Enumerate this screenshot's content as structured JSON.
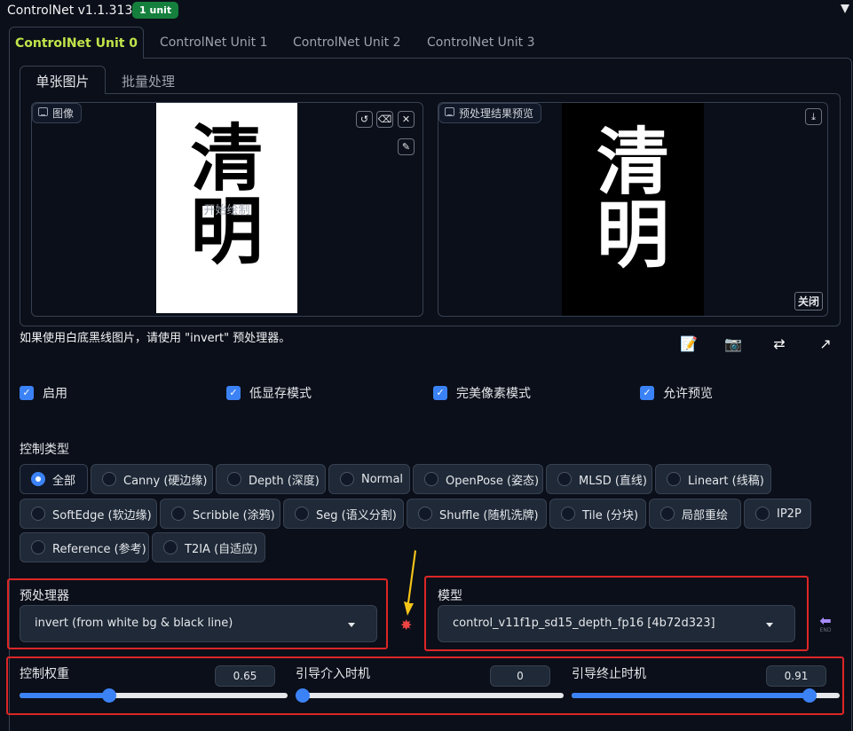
{
  "app": {
    "title": "ControlNet v1.1.313",
    "badge": "1 unit"
  },
  "unit_tabs": [
    "ControlNet Unit 0",
    "ControlNet Unit 1",
    "ControlNet Unit 2",
    "ControlNet Unit 3"
  ],
  "sub_tabs": [
    "单张图片",
    "批量处理"
  ],
  "image_panel": {
    "label": "图像",
    "overlay_text": "开始绘制",
    "calligraphy": "清明"
  },
  "preview_panel": {
    "label": "预处理结果预览",
    "close_label": "关闭",
    "calligraphy": "清明"
  },
  "note": "如果使用白底黑线图片，请使用 \"invert\" 预处理器。",
  "checkboxes": [
    {
      "label": "启用",
      "checked": true
    },
    {
      "label": "低显存模式",
      "checked": true
    },
    {
      "label": "完美像素模式",
      "checked": true
    },
    {
      "label": "允许预览",
      "checked": true
    }
  ],
  "control_type": {
    "label": "控制类型",
    "options": [
      "全部",
      "Canny (硬边缘)",
      "Depth (深度)",
      "Normal",
      "OpenPose (姿态)",
      "MLSD (直线)",
      "Lineart (线稿)",
      "SoftEdge (软边缘)",
      "Scribble (涂鸦)",
      "Seg (语义分割)",
      "Shuffle (随机洗牌)",
      "Tile (分块)",
      "局部重绘",
      "IP2P",
      "Reference (参考)",
      "T2IA (自适应)"
    ],
    "selected": "全部"
  },
  "preprocessor": {
    "label": "预处理器",
    "value": "invert (from white bg & black line)"
  },
  "model": {
    "label": "模型",
    "value": "control_v11f1p_sd15_depth_fp16 [4b72d323]"
  },
  "end_label": "END",
  "sliders": [
    {
      "label": "控制权重",
      "value": "0.65",
      "fraction": 0.325
    },
    {
      "label": "引导介入时机",
      "value": "0",
      "fraction": 0.0
    },
    {
      "label": "引导终止时机",
      "value": "0.91",
      "fraction": 0.91
    }
  ],
  "colors": {
    "accent": "#3b82f6",
    "active_tab": "#c0e44a",
    "badge": "#15803d",
    "highlight": "#dc2626"
  }
}
